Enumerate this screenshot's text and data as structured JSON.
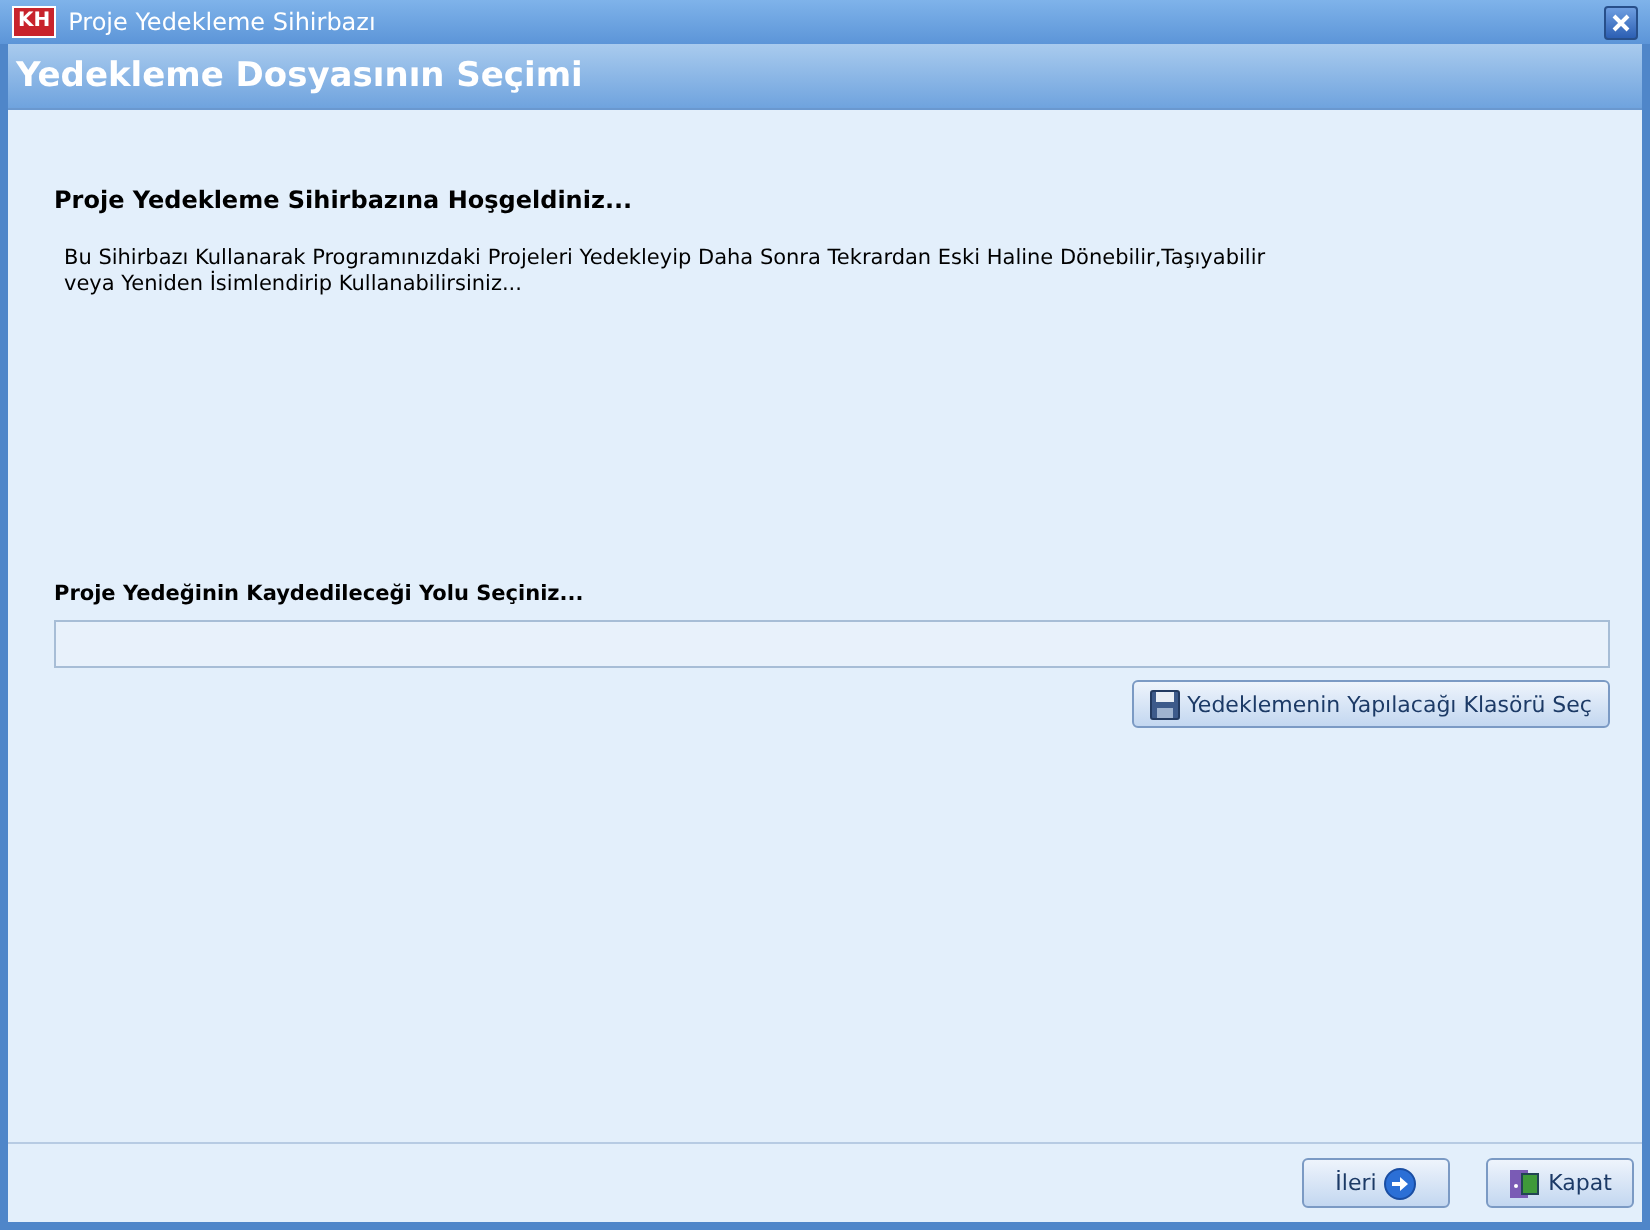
{
  "window": {
    "app_badge": "KH",
    "title": "Proje Yedekleme Sihirbazı"
  },
  "header": {
    "title": "Yedekleme Dosyasının Seçimi"
  },
  "welcome": {
    "heading": "Proje Yedekleme Sihirbazına Hoşgeldiniz...",
    "text": "Bu Sihirbazı Kullanarak Programınızdaki Projeleri Yedekleyip Daha Sonra Tekrardan Eski Haline Dönebilir,Taşıyabilir veya Yeniden İsimlendirip Kullanabilirsiniz..."
  },
  "path": {
    "label": "Proje Yedeğinin Kaydedileceği Yolu Seçiniz...",
    "browse_button": "Yedeklemenin Yapılacağı Klasörü Seç"
  },
  "buttons": [
    {
      "kind": "next",
      "label": "İleri"
    },
    {
      "kind": "close",
      "label": "Kapat"
    }
  ]
}
